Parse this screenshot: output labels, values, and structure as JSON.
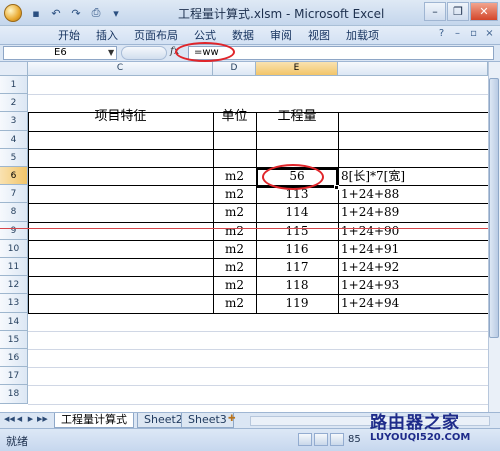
{
  "window": {
    "title": "工程量计算式.xlsm - Microsoft Excel",
    "minimize_icon": "minimize-icon",
    "restore_icon": "restore-icon",
    "close_icon": "close-icon"
  },
  "quick_access": [
    "save-icon",
    "undo-icon",
    "redo-icon",
    "print-preview-icon",
    "customize-icon"
  ],
  "ribbon": {
    "tabs": [
      "开始",
      "插入",
      "页面布局",
      "公式",
      "数据",
      "审阅",
      "视图",
      "加载项"
    ]
  },
  "formula_bar": {
    "name_box": "E6",
    "fx": "fx",
    "formula": "=ww"
  },
  "grid": {
    "columns": [
      "C",
      "D",
      "E"
    ],
    "active_column": "E",
    "rows": [
      "1",
      "2",
      "3",
      "4",
      "5",
      "6",
      "7",
      "8",
      "9",
      "10",
      "11",
      "12",
      "13",
      "14",
      "15",
      "16",
      "17",
      "18"
    ],
    "active_row": "6",
    "headers": {
      "c": "项目特征",
      "d": "单位",
      "e": "工程量"
    },
    "data_rows": [
      {
        "row": "6",
        "unit": "m2",
        "qty": "56",
        "formula": "8[长]*7[宽]"
      },
      {
        "row": "7",
        "unit": "m2",
        "qty": "113",
        "formula": "1+24+88"
      },
      {
        "row": "8",
        "unit": "m2",
        "qty": "114",
        "formula": "1+24+89"
      },
      {
        "row": "9",
        "unit": "m2",
        "qty": "115",
        "formula": "1+24+90"
      },
      {
        "row": "10",
        "unit": "m2",
        "qty": "116",
        "formula": "1+24+91"
      },
      {
        "row": "11",
        "unit": "m2",
        "qty": "117",
        "formula": "1+24+92"
      },
      {
        "row": "12",
        "unit": "m2",
        "qty": "118",
        "formula": "1+24+93"
      },
      {
        "row": "13",
        "unit": "m2",
        "qty": "119",
        "formula": "1+24+94"
      }
    ]
  },
  "sheet_tabs": [
    "工程量计算式",
    "Sheet2",
    "Sheet3"
  ],
  "active_sheet": "工程量计算式",
  "status": {
    "ready": "就绪",
    "zoom": "85"
  },
  "watermark": {
    "top": "路由器之家",
    "bottom": "LUYOUQI520.COM"
  }
}
